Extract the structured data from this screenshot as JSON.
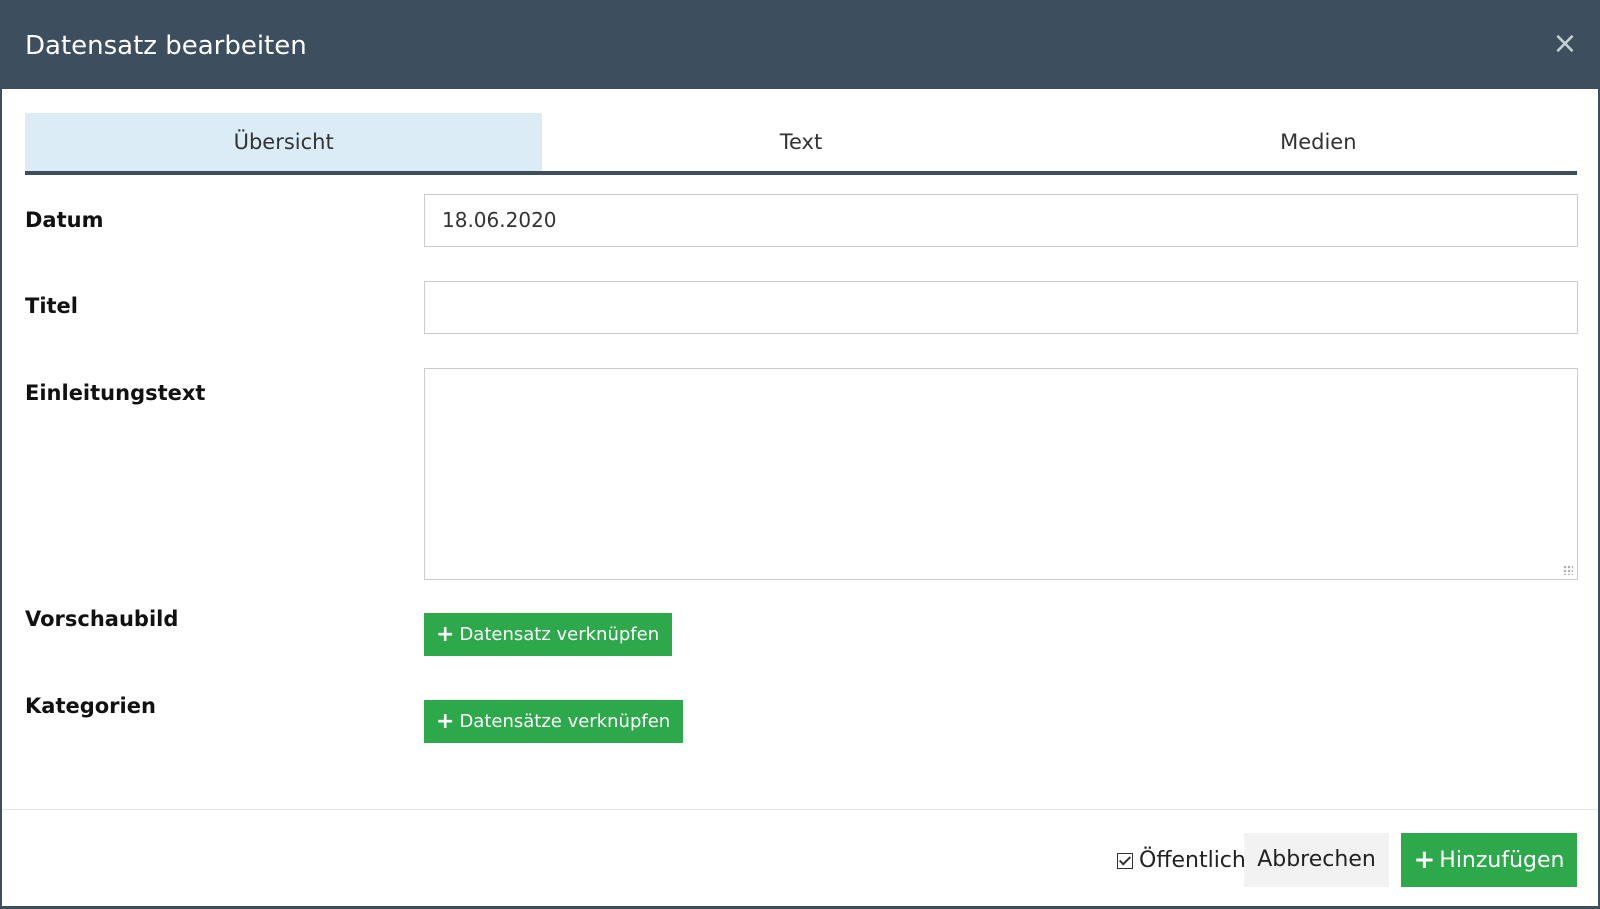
{
  "dialog": {
    "title": "Datensatz bearbeiten",
    "close_icon": "×"
  },
  "tabs": [
    {
      "label": "Übersicht",
      "active": true
    },
    {
      "label": "Text",
      "active": false
    },
    {
      "label": "Medien",
      "active": false
    }
  ],
  "form": {
    "datum": {
      "label": "Datum",
      "value": "18.06.2020"
    },
    "titel": {
      "label": "Titel",
      "value": ""
    },
    "einleitungstext": {
      "label": "Einleitungstext",
      "value": ""
    },
    "vorschaubild": {
      "label": "Vorschaubild",
      "button_label": "Datensatz verknüpfen"
    },
    "kategorien": {
      "label": "Kategorien",
      "button_label": "Datensätze verknüpfen"
    }
  },
  "footer": {
    "public_label": "Öffentlich",
    "public_checked": true,
    "cancel_label": "Abbrechen",
    "add_label": "Hinzufügen"
  },
  "icons": {
    "plus": "+",
    "close": "×"
  },
  "colors": {
    "header_bg": "#3d4f5e",
    "active_tab_bg": "#dcecf7",
    "button_green": "#2da84a",
    "cancel_bg": "#f2f2f2"
  }
}
